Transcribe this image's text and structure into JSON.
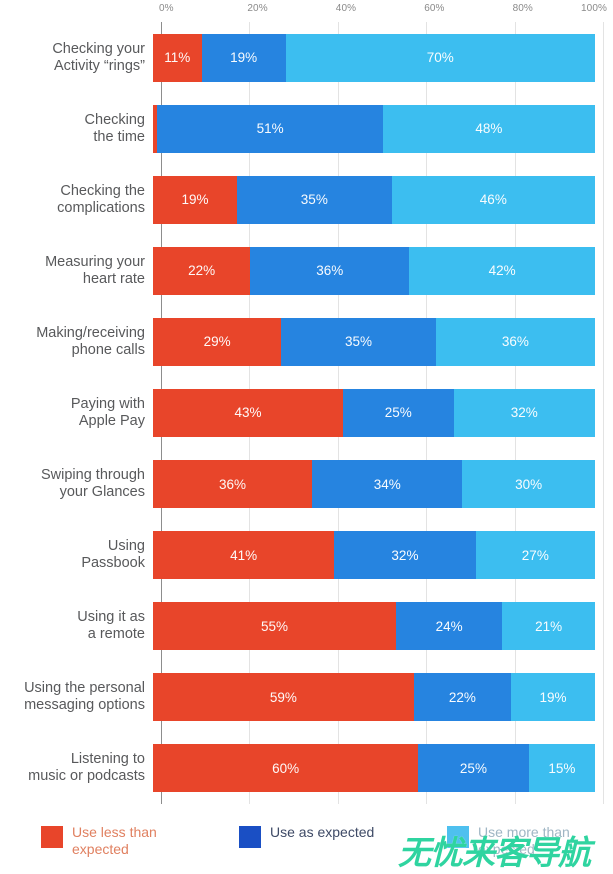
{
  "chart_data": {
    "type": "bar",
    "subtype": "horizontal-stacked-100",
    "title": "",
    "xlabel": "",
    "ylabel": "",
    "xlim": [
      0,
      100
    ],
    "xticks": [
      "0%",
      "20%",
      "40%",
      "60%",
      "80%",
      "100%"
    ],
    "xtick_values": [
      0,
      20,
      40,
      60,
      80,
      100
    ],
    "grid": true,
    "legend_position": "bottom",
    "categories": [
      "Checking your\nActivity “rings”",
      "Checking\nthe time",
      "Checking the\ncomplications",
      "Measuring your\nheart rate",
      "Making/receiving\nphone calls",
      "Paying with\nApple Pay",
      "Swiping through\nyour Glances",
      "Using\nPassbook",
      "Using it as\na remote",
      "Using the personal\nmessaging options",
      "Listening to\nmusic or podcasts"
    ],
    "series": [
      {
        "name": "Use less than expected",
        "color": "#e8452a",
        "values": [
          11,
          1,
          19,
          22,
          29,
          43,
          36,
          41,
          55,
          59,
          60
        ],
        "labels": [
          "11%",
          "",
          "19%",
          "22%",
          "29%",
          "43%",
          "36%",
          "41%",
          "55%",
          "59%",
          "60%"
        ]
      },
      {
        "name": "Use as expected",
        "color": "#2684e0",
        "values": [
          19,
          51,
          35,
          36,
          35,
          25,
          34,
          32,
          24,
          22,
          25
        ],
        "labels": [
          "19%",
          "51%",
          "35%",
          "36%",
          "35%",
          "25%",
          "34%",
          "32%",
          "24%",
          "22%",
          "25%"
        ]
      },
      {
        "name": "Use more than expected",
        "color": "#3cbef0",
        "values": [
          70,
          48,
          46,
          42,
          36,
          32,
          30,
          27,
          21,
          19,
          15
        ],
        "labels": [
          "70%",
          "48%",
          "46%",
          "42%",
          "36%",
          "32%",
          "30%",
          "27%",
          "21%",
          "19%",
          "15%"
        ]
      }
    ]
  },
  "legend": {
    "items": [
      {
        "label": "Use less than\nexpected",
        "color": "#e8452a"
      },
      {
        "label": "Use as expected",
        "color": "#1a4fc4"
      },
      {
        "label": "Use more than\nexpected",
        "color": "#4ec0ef"
      }
    ]
  },
  "watermark": {
    "text": "无忧来客导航",
    "color": "#2fd4a0"
  }
}
